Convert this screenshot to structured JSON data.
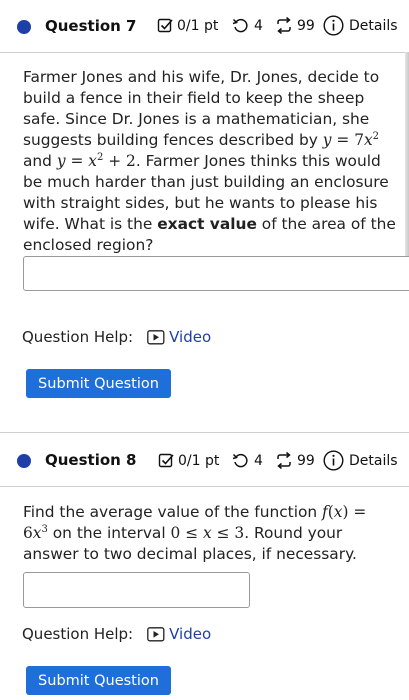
{
  "q7": {
    "title": "Question 7",
    "score": "0/1 pt",
    "retries": "4",
    "submissions": "99",
    "details": "Details",
    "text_parts": {
      "intro": "Farmer Jones and his wife, Dr. Jones, decide to build a fence in their field to keep the sheep safe. Since Dr. Jones is a mathematician, she suggests building fences described by ",
      "and": " and ",
      "period": ".",
      "rest": " Farmer Jones thinks this would be much harder than just building an enclosure with straight sides, but he wants to please his wife. What is the ",
      "bold": "exact value",
      "end": " of the area of the enclosed region?"
    },
    "help_label": "Question Help:",
    "video_label": "Video",
    "submit_label": "Submit Question"
  },
  "q8": {
    "title": "Question 8",
    "score": "0/1 pt",
    "retries": "4",
    "submissions": "99",
    "details": "Details",
    "text_parts": {
      "intro": "Find the average value of the function ",
      "on": " on the interval ",
      "end": ". Round your answer to two decimal places, if necessary."
    },
    "help_label": "Question Help:",
    "video_label": "Video",
    "submit_label": "Submit Question"
  },
  "colors": {
    "accent": "#1e6fd9",
    "dot": "#1f3fa8",
    "link": "#1f3fa8"
  }
}
